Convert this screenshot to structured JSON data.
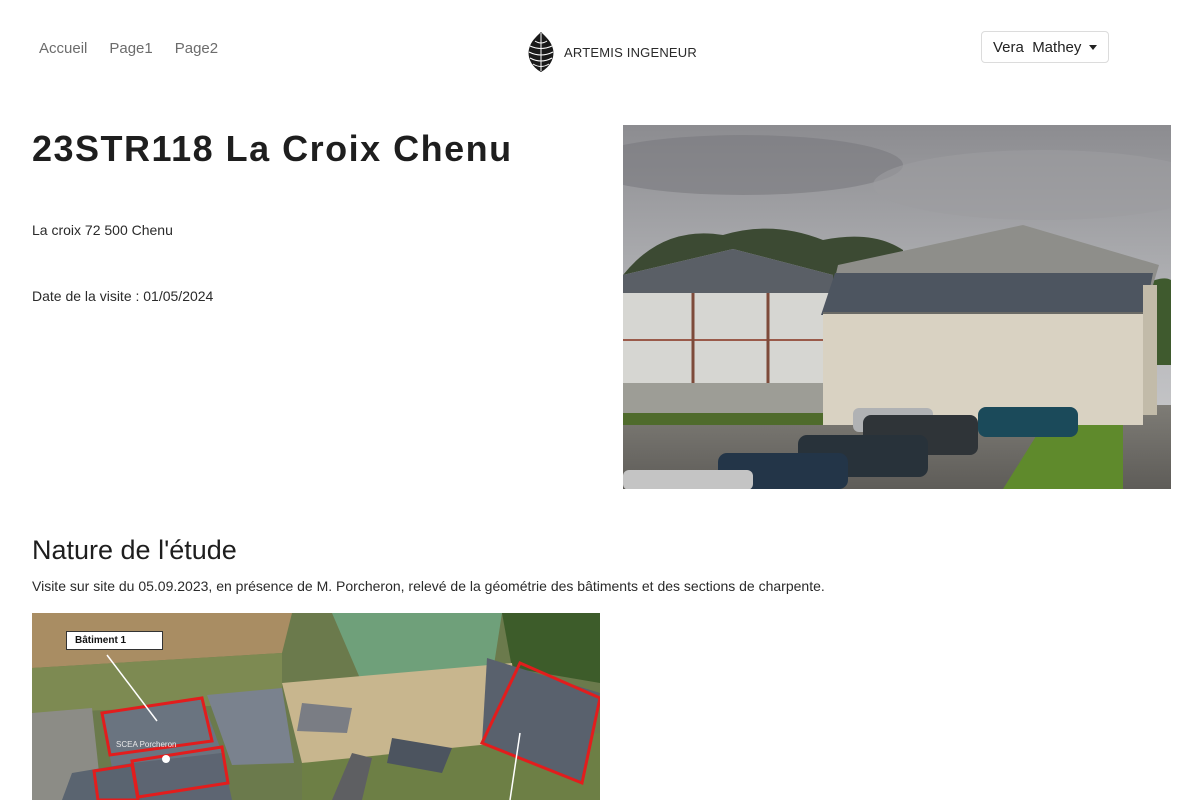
{
  "nav": {
    "items": [
      "Accueil",
      "Page1",
      "Page2"
    ]
  },
  "brand": {
    "name": "ARTEMIS INGENEUR",
    "logo_icon": "pinecone-icon"
  },
  "user": {
    "name": "Vera  Mathey"
  },
  "project": {
    "title": "23STR118 La Croix Chenu",
    "address": "La croix 72 500 Chenu",
    "visit_date": "Date de la visite : 01/05/2024"
  },
  "study": {
    "heading": "Nature de l'étude",
    "description": "Visite sur site du 05.09.2023, en présence de M. Porcheron, relevé de la géométrie des bâtiments et des sections de charpente.",
    "map_label": "Bâtiment 1",
    "map_place": "SCEA Porcheron"
  },
  "colors": {
    "nav_text": "#6c6c6c",
    "highlight": "#e21d1d"
  }
}
